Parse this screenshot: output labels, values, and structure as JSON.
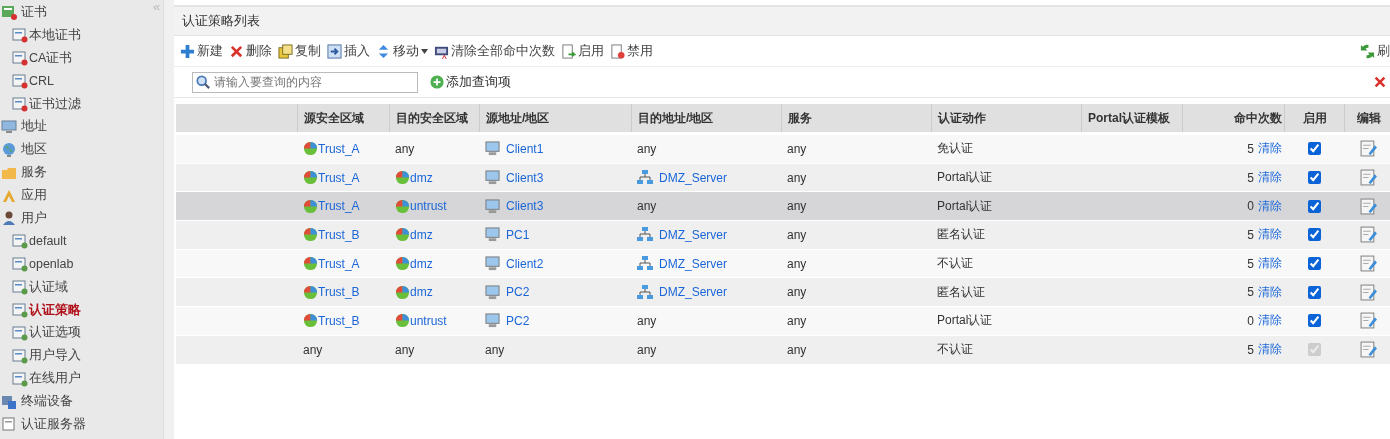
{
  "sidebar": {
    "items": [
      {
        "label": "证书",
        "selected": false,
        "children": [
          {
            "label": "本地证书",
            "selected": false
          },
          {
            "label": "CA证书",
            "selected": false
          },
          {
            "label": "CRL",
            "selected": false
          },
          {
            "label": "证书过滤",
            "selected": false
          }
        ]
      },
      {
        "label": "地址",
        "selected": false
      },
      {
        "label": "地区",
        "selected": false
      },
      {
        "label": "服务",
        "selected": false
      },
      {
        "label": "应用",
        "selected": false
      },
      {
        "label": "用户",
        "selected": false,
        "children": [
          {
            "label": "default",
            "selected": false
          },
          {
            "label": "openlab",
            "selected": false
          },
          {
            "label": "认证域",
            "selected": false
          },
          {
            "label": "认证策略",
            "selected": true
          },
          {
            "label": "认证选项",
            "selected": false
          },
          {
            "label": "用户导入",
            "selected": false
          },
          {
            "label": "在线用户",
            "selected": false
          }
        ]
      },
      {
        "label": "终端设备",
        "selected": false
      },
      {
        "label": "认证服务器",
        "selected": false
      }
    ],
    "collapse": "«"
  },
  "panel": {
    "title": "认证策略列表",
    "toolbar": [
      {
        "label": "新建",
        "kind": "plus"
      },
      {
        "label": "删除",
        "kind": "cross"
      },
      {
        "label": "复制",
        "kind": "copy"
      },
      {
        "label": "插入",
        "kind": "insert"
      },
      {
        "label": "移动",
        "kind": "move"
      },
      {
        "label": "清除全部命中次数",
        "kind": "counter"
      },
      {
        "label": "启用",
        "kind": "enable"
      },
      {
        "label": "禁用",
        "kind": "disable"
      }
    ],
    "refresh": "刷",
    "search": {
      "placeholder": "请输入要查询的内容"
    },
    "add_query": "添加查询项",
    "table": {
      "columns": [
        "源安全区域",
        "目的安全区域",
        "源地址/地区",
        "目的地址/地区",
        "服务",
        "认证动作",
        "Portal认证模板",
        "命中次数",
        "启用",
        "编辑"
      ],
      "rows": [
        {
          "selected": false,
          "cells": [
            {
              "text": "Trust_A",
              "kind": "zone"
            },
            {
              "text": "any",
              "kind": "plain"
            },
            {
              "text": "Client1",
              "kind": "host"
            },
            {
              "text": "any",
              "kind": "plain"
            },
            {
              "text": "any",
              "kind": "plain"
            },
            {
              "text": "免认证",
              "kind": "plain"
            }
          ],
          "hits": "5",
          "clear": "清除",
          "enabled": true,
          "disabled": false
        },
        {
          "selected": false,
          "cells": [
            {
              "text": "Trust_A",
              "kind": "zone"
            },
            {
              "text": "dmz",
              "kind": "zone"
            },
            {
              "text": "Client3",
              "kind": "host"
            },
            {
              "text": "DMZ_Server",
              "kind": "server"
            },
            {
              "text": "any",
              "kind": "plain"
            },
            {
              "text": "Portal认证",
              "kind": "plain"
            }
          ],
          "hits": "5",
          "clear": "清除",
          "enabled": true,
          "disabled": false
        },
        {
          "selected": true,
          "cells": [
            {
              "text": "Trust_A",
              "kind": "zone"
            },
            {
              "text": "untrust",
              "kind": "zone"
            },
            {
              "text": "Client3",
              "kind": "host"
            },
            {
              "text": "any",
              "kind": "plain"
            },
            {
              "text": "any",
              "kind": "plain"
            },
            {
              "text": "Portal认证",
              "kind": "plain"
            }
          ],
          "hits": "0",
          "clear": "清除",
          "enabled": true,
          "disabled": false
        },
        {
          "selected": false,
          "cells": [
            {
              "text": "Trust_B",
              "kind": "zone"
            },
            {
              "text": "dmz",
              "kind": "zone"
            },
            {
              "text": "PC1",
              "kind": "host"
            },
            {
              "text": "DMZ_Server",
              "kind": "server"
            },
            {
              "text": "any",
              "kind": "plain"
            },
            {
              "text": "匿名认证",
              "kind": "plain"
            }
          ],
          "hits": "5",
          "clear": "清除",
          "enabled": true,
          "disabled": false
        },
        {
          "selected": false,
          "cells": [
            {
              "text": "Trust_A",
              "kind": "zone"
            },
            {
              "text": "dmz",
              "kind": "zone"
            },
            {
              "text": "Client2",
              "kind": "host"
            },
            {
              "text": "DMZ_Server",
              "kind": "server"
            },
            {
              "text": "any",
              "kind": "plain"
            },
            {
              "text": "不认证",
              "kind": "plain"
            }
          ],
          "hits": "5",
          "clear": "清除",
          "enabled": true,
          "disabled": false
        },
        {
          "selected": false,
          "cells": [
            {
              "text": "Trust_B",
              "kind": "zone"
            },
            {
              "text": "dmz",
              "kind": "zone"
            },
            {
              "text": "PC2",
              "kind": "host"
            },
            {
              "text": "DMZ_Server",
              "kind": "server"
            },
            {
              "text": "any",
              "kind": "plain"
            },
            {
              "text": "匿名认证",
              "kind": "plain"
            }
          ],
          "hits": "5",
          "clear": "清除",
          "enabled": true,
          "disabled": false
        },
        {
          "selected": false,
          "cells": [
            {
              "text": "Trust_B",
              "kind": "zone"
            },
            {
              "text": "untrust",
              "kind": "zone"
            },
            {
              "text": "PC2",
              "kind": "host"
            },
            {
              "text": "any",
              "kind": "plain"
            },
            {
              "text": "any",
              "kind": "plain"
            },
            {
              "text": "Portal认证",
              "kind": "plain"
            }
          ],
          "hits": "0",
          "clear": "清除",
          "enabled": true,
          "disabled": false
        },
        {
          "selected": false,
          "cells": [
            {
              "text": "any",
              "kind": "plain"
            },
            {
              "text": "any",
              "kind": "plain"
            },
            {
              "text": "any",
              "kind": "plain"
            },
            {
              "text": "any",
              "kind": "plain"
            },
            {
              "text": "any",
              "kind": "plain"
            },
            {
              "text": "不认证",
              "kind": "plain"
            }
          ],
          "hits": "5",
          "clear": "清除",
          "enabled": true,
          "disabled": true
        }
      ]
    }
  }
}
